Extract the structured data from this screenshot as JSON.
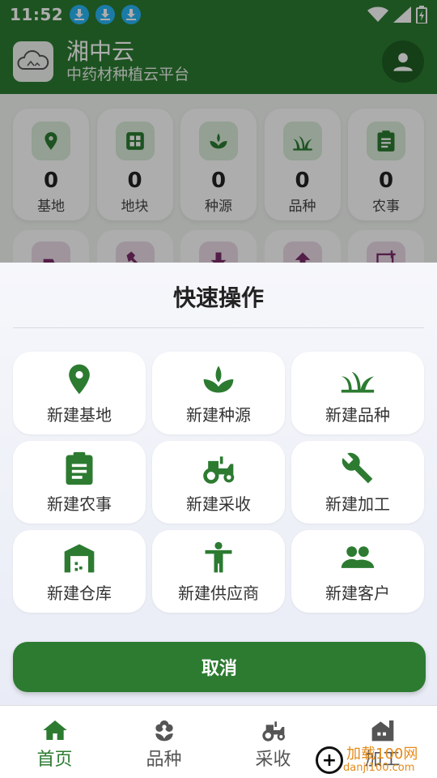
{
  "statusbar": {
    "time": "11:52"
  },
  "header": {
    "title": "湘中云",
    "subtitle": "中药材种植云平台"
  },
  "stats": [
    {
      "value": "0",
      "label": "基地",
      "icon": "location-pin-icon"
    },
    {
      "value": "0",
      "label": "地块",
      "icon": "grid-icon"
    },
    {
      "value": "0",
      "label": "种源",
      "icon": "sprout-icon"
    },
    {
      "value": "0",
      "label": "品种",
      "icon": "grass-icon"
    },
    {
      "value": "0",
      "label": "农事",
      "icon": "clipboard-icon"
    }
  ],
  "sheet": {
    "title": "快速操作",
    "actions": [
      {
        "label": "新建基地",
        "icon": "location-pin-icon"
      },
      {
        "label": "新建种源",
        "icon": "sprout-icon"
      },
      {
        "label": "新建品种",
        "icon": "grass-icon"
      },
      {
        "label": "新建农事",
        "icon": "clipboard-icon"
      },
      {
        "label": "新建采收",
        "icon": "tractor-icon"
      },
      {
        "label": "新建加工",
        "icon": "wrench-icon"
      },
      {
        "label": "新建仓库",
        "icon": "warehouse-icon"
      },
      {
        "label": "新建供应商",
        "icon": "person-icon"
      },
      {
        "label": "新建客户",
        "icon": "people-icon"
      }
    ],
    "cancel": "取消"
  },
  "nav": [
    {
      "label": "首页",
      "icon": "home-icon"
    },
    {
      "label": "品种",
      "icon": "flower-icon"
    },
    {
      "label": "采收",
      "icon": "tractor-icon"
    },
    {
      "label": "加工",
      "icon": "factory-icon"
    }
  ],
  "watermark": {
    "brand": "加载100网",
    "url": "danji100.com"
  },
  "colors": {
    "primary": "#2c7b31",
    "accent_purple": "#7b2d6b"
  }
}
